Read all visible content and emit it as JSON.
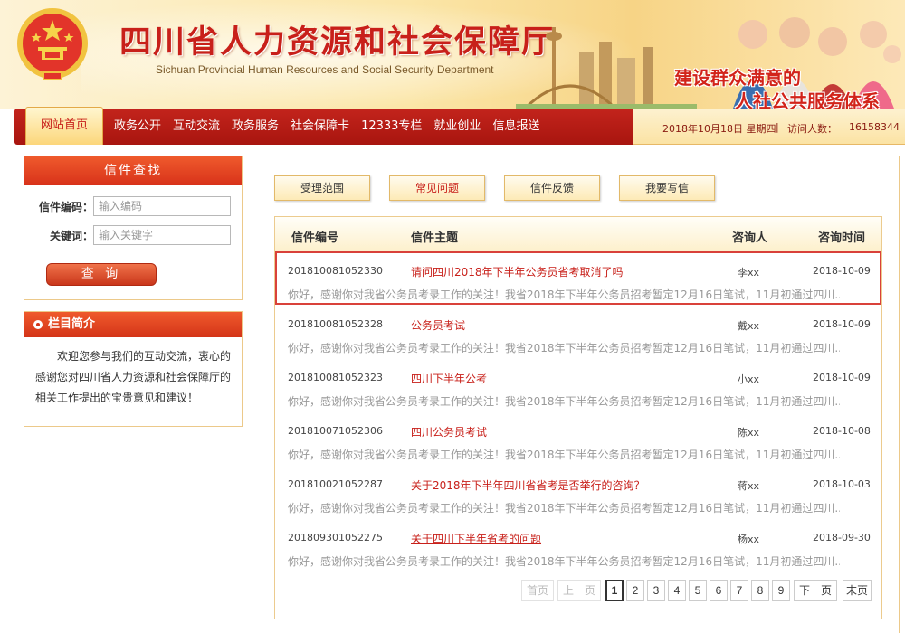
{
  "header": {
    "title": "四川省人力资源和社会保障厅",
    "subtitle": "Sichuan Provincial Human Resources and Social Security Department",
    "slogan_line1": "建设群众满意的",
    "slogan_line2": "人社公共服务体系"
  },
  "nav": {
    "home": "网站首页",
    "items": [
      "政务公开",
      "互动交流",
      "政务服务",
      "社会保障卡",
      "12333专栏",
      "就业创业",
      "信息报送"
    ],
    "date": "2018年10月18日 星期四",
    "separator": "|",
    "visitor_label": "访问人数：",
    "visitor_count": "16158344"
  },
  "search_box": {
    "title": "信件查找",
    "code_label": "信件编码：",
    "code_placeholder": "输入编码",
    "keyword_label": "关键词：",
    "keyword_placeholder": "输入关键字",
    "query_button": "查 询"
  },
  "intro_box": {
    "title": "栏目简介",
    "text": "欢迎您参与我们的互动交流，衷心的感谢您对四川省人力资源和社会保障厅的相关工作提出的宝贵意见和建议！"
  },
  "tabs": [
    {
      "label": "受理范围",
      "active": false
    },
    {
      "label": "常见问题",
      "active": true
    },
    {
      "label": "信件反馈",
      "active": false
    },
    {
      "label": "我要写信",
      "active": false
    }
  ],
  "table": {
    "headers": {
      "number": "信件编号",
      "subject": "信件主题",
      "asker": "咨询人",
      "time": "咨询时间"
    },
    "rows": [
      {
        "number": "201810081052330",
        "subject": "请问四川2018年下半年公务员省考取消了吗",
        "asker": "李xx",
        "time": "2018-10-09",
        "snippet": "你好，感谢你对我省公务员考录工作的关注！我省2018年下半年公务员招考暂定12月16日笔试，11月初通过四川..."
      },
      {
        "number": "201810081052328",
        "subject": "公务员考试",
        "asker": "戴xx",
        "time": "2018-10-09",
        "snippet": "你好，感谢你对我省公务员考录工作的关注！我省2018年下半年公务员招考暂定12月16日笔试，11月初通过四川..."
      },
      {
        "number": "201810081052323",
        "subject": "四川下半年公考",
        "asker": "小xx",
        "time": "2018-10-09",
        "snippet": "你好，感谢你对我省公务员考录工作的关注！我省2018年下半年公务员招考暂定12月16日笔试，11月初通过四川..."
      },
      {
        "number": "201810071052306",
        "subject": "四川公务员考试",
        "asker": "陈xx",
        "time": "2018-10-08",
        "snippet": "你好，感谢你对我省公务员考录工作的关注！我省2018年下半年公务员招考暂定12月16日笔试，11月初通过四川..."
      },
      {
        "number": "201810021052287",
        "subject": "关于2018年下半年四川省省考是否举行的咨询？",
        "asker": "蒋xx",
        "time": "2018-10-03",
        "snippet": "你好，感谢你对我省公务员考录工作的关注！我省2018年下半年公务员招考暂定12月16日笔试，11月初通过四川..."
      },
      {
        "number": "201809301052275",
        "subject": "关于四川下半年省考的问题",
        "asker": "杨xx",
        "time": "2018-09-30",
        "snippet": "你好，感谢你对我省公务员考录工作的关注！我省2018年下半年公务员招考暂定12月16日笔试，11月初通过四川..."
      }
    ]
  },
  "pager": {
    "first": "首页",
    "prev": "上一页",
    "pages": [
      "1",
      "2",
      "3",
      "4",
      "5",
      "6",
      "7",
      "8",
      "9"
    ],
    "current": "1",
    "next": "下一页",
    "last": "末页"
  },
  "colors": {
    "brand_red": "#c8201a",
    "banner_gold": "#fbe6a8",
    "highlight_border": "#d9413a"
  }
}
